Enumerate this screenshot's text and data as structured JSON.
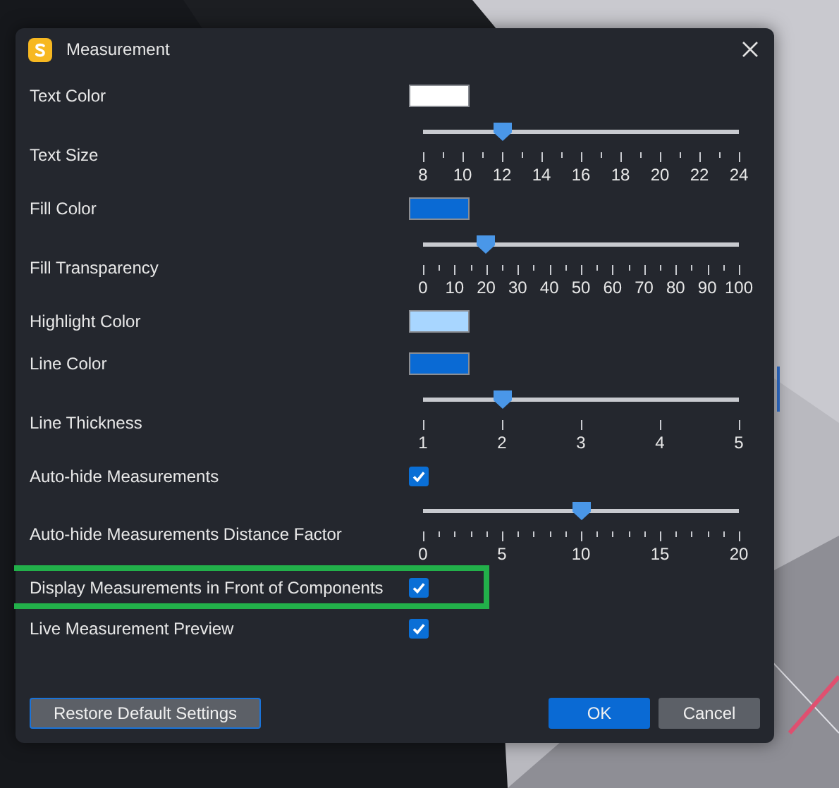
{
  "window": {
    "title": "Measurement"
  },
  "rows": [
    {
      "kind": "color",
      "label": "Text Color",
      "color": "#ffffff"
    },
    {
      "kind": "slider",
      "label": "Text Size",
      "level": 0.25,
      "ticks": [
        "8",
        "10",
        "12",
        "14",
        "16",
        "18",
        "20",
        "22",
        "24"
      ]
    },
    {
      "kind": "color",
      "label": "Fill Color",
      "color": "#0a6ad4"
    },
    {
      "kind": "slider",
      "label": "Fill Transparency",
      "level": 0.2,
      "ticks": [
        "0",
        "10",
        "20",
        "30",
        "40",
        "50",
        "60",
        "70",
        "80",
        "90",
        "100"
      ]
    },
    {
      "kind": "color",
      "label": "Highlight Color",
      "color": "#a8d6ff"
    },
    {
      "kind": "color",
      "label": "Line Color",
      "color": "#0a6ad4"
    },
    {
      "kind": "slider",
      "label": "Line Thickness",
      "level": 0.25,
      "ticks": [
        "1",
        "2",
        "3",
        "4",
        "5"
      ]
    },
    {
      "kind": "checkbox",
      "label": "Auto-hide Measurements",
      "checked": true
    },
    {
      "kind": "slider",
      "label": "Auto-hide Measurements Distance Factor",
      "level": 0.5,
      "ticks": [
        "0",
        "5",
        "10",
        "15",
        "20"
      ]
    },
    {
      "kind": "checkbox",
      "label": "Display Measurements in Front of Components",
      "checked": true,
      "highlighted": true
    },
    {
      "kind": "checkbox",
      "label": "Live Measurement Preview",
      "checked": true
    }
  ],
  "buttons": [
    {
      "label": "Restore Default Settings",
      "kind": "secondary"
    },
    {
      "label": "OK",
      "kind": "primary"
    },
    {
      "label": "Cancel",
      "kind": "neutral"
    }
  ]
}
